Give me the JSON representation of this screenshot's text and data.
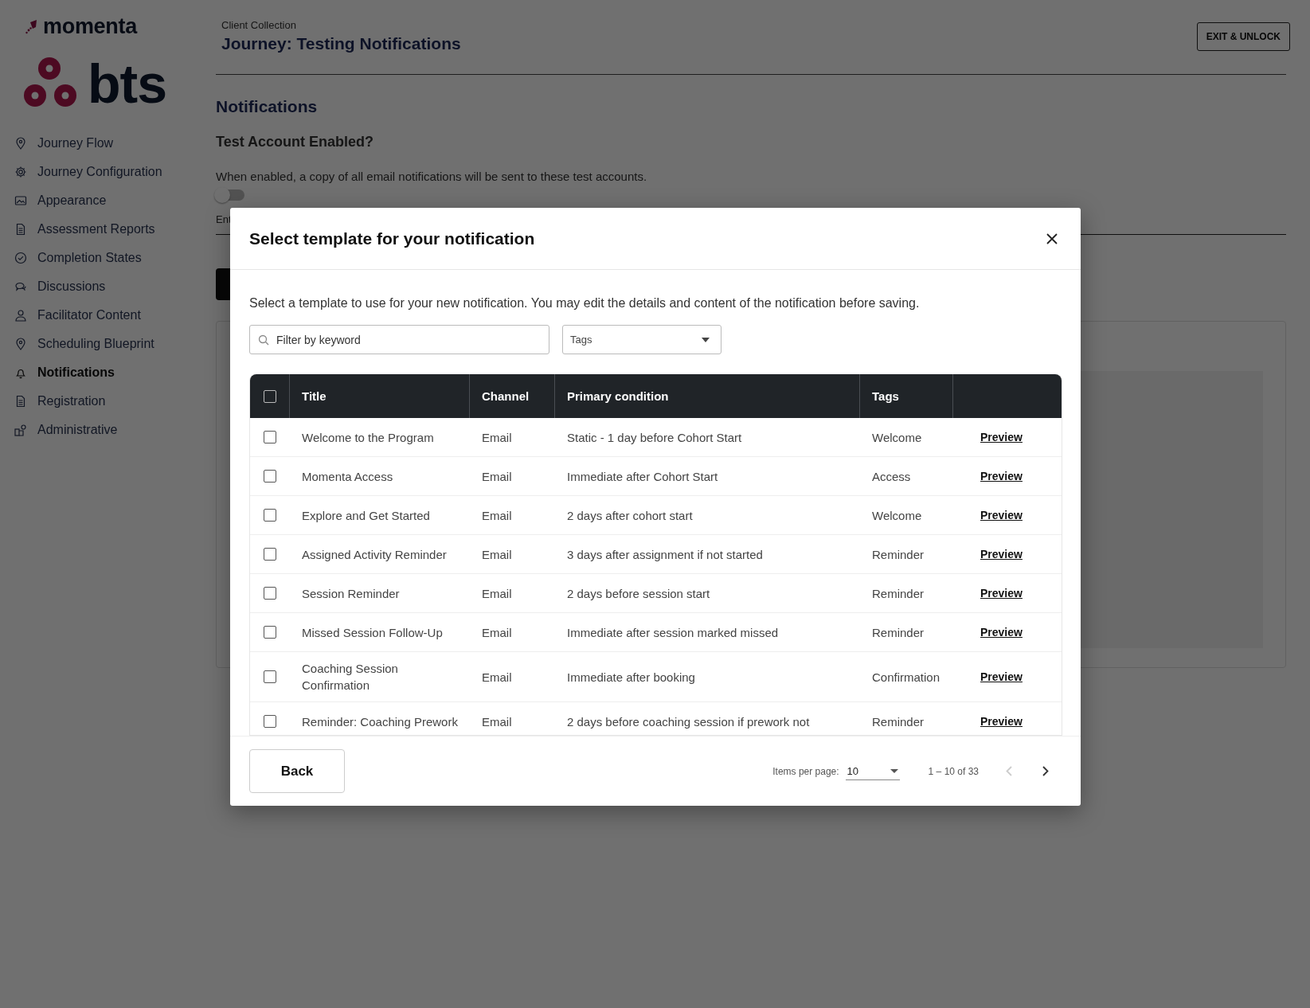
{
  "logo": {
    "product": "momenta",
    "company": "bts"
  },
  "sidebar": {
    "items": [
      {
        "label": "Journey Flow",
        "selected": false
      },
      {
        "label": "Journey Configuration",
        "selected": false
      },
      {
        "label": "Appearance",
        "selected": false
      },
      {
        "label": "Assessment Reports",
        "selected": false
      },
      {
        "label": "Completion States",
        "selected": false
      },
      {
        "label": "Discussions",
        "selected": false
      },
      {
        "label": "Facilitator Content",
        "selected": false
      },
      {
        "label": "Scheduling Blueprint",
        "selected": false
      },
      {
        "label": "Notifications",
        "selected": true
      },
      {
        "label": "Registration",
        "selected": false
      },
      {
        "label": "Administrative",
        "selected": false
      }
    ]
  },
  "header": {
    "breadcrumb": "Client Collection",
    "title": "Journey: Testing Notifications",
    "exit_button": "EXIT & UNLOCK"
  },
  "page": {
    "heading": "Notifications",
    "test_account": {
      "label": "Test Account Enabled?",
      "description": "When enabled, a copy of all email notifications will be sent to these test accounts.",
      "on": false
    },
    "field_label": "Ent"
  },
  "dialog": {
    "title": "Select template for your notification",
    "intro": "Select a template to use for your new notification. You may edit the details and content of the notification before saving.",
    "search": {
      "placeholder": "Filter by keyword"
    },
    "tags_filter": {
      "placeholder": "Tags"
    },
    "table": {
      "select_all": {
        "checked": false
      },
      "columns": [
        "Title",
        "Channel",
        "Primary condition",
        "Tags"
      ],
      "rows": [
        {
          "checked": false,
          "title": "Welcome to the Program",
          "channel": "Email",
          "condition": "Static - 1 day before Cohort Start",
          "tag": "Welcome",
          "action": "Preview"
        },
        {
          "checked": false,
          "title": "Momenta Access",
          "channel": "Email",
          "condition": "Immediate after Cohort Start",
          "tag": "Access",
          "action": "Preview"
        },
        {
          "checked": false,
          "title": "Explore and Get Started",
          "channel": "Email",
          "condition": "2 days after cohort start",
          "tag": "Welcome",
          "action": "Preview"
        },
        {
          "checked": false,
          "title": "Assigned Activity Reminder",
          "channel": "Email",
          "condition": "3 days after assignment if not started",
          "tag": "Reminder",
          "action": "Preview"
        },
        {
          "checked": false,
          "title": "Session Reminder",
          "channel": "Email",
          "condition": "2 days before session start",
          "tag": "Reminder",
          "action": "Preview"
        },
        {
          "checked": false,
          "title": "Missed Session Follow-Up",
          "channel": "Email",
          "condition": "Immediate after session marked missed",
          "tag": "Reminder",
          "action": "Preview"
        },
        {
          "checked": false,
          "title": "Coaching Session Confirmation",
          "channel": "Email",
          "condition": "Immediate after booking",
          "tag": "Confirmation",
          "action": "Preview"
        },
        {
          "checked": false,
          "title": "Reminder: Coaching Prework",
          "channel": "Email",
          "condition": "2 days before coaching session if prework not",
          "tag": "Reminder",
          "action": "Preview"
        }
      ]
    },
    "back_button": "Back",
    "pagination": {
      "items_per_page_label": "Items per page:",
      "page_size": "10",
      "range": "1 – 10 of 33",
      "previous_disabled": true,
      "next_disabled": false
    }
  }
}
